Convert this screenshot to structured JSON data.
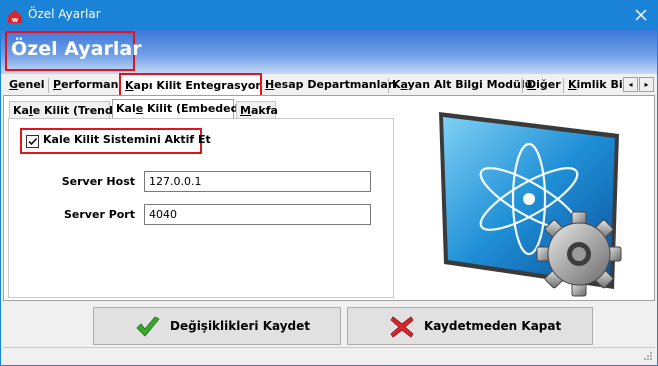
{
  "window": {
    "title": "Özel Ayarlar",
    "close_glyph": "✕"
  },
  "header": {
    "title": "Özel Ayarlar"
  },
  "main_tabs": [
    {
      "label": "Genel",
      "accel": "G",
      "rest": "enel"
    },
    {
      "label": "Performans",
      "accel": "P",
      "rest": "erformans"
    },
    {
      "label": "Kapı Kilit Entegrasyonu",
      "accel": "K",
      "rest": "apı Kilit Entegrasyonu",
      "active": true
    },
    {
      "label": "Hesap Departmanları",
      "accel": "H",
      "rest": "esap Departmanları"
    },
    {
      "label": "Kayan Alt Bilgi Modülü",
      "accel": "a",
      "pre": "K",
      "rest": "yan Alt Bilgi Modülü"
    },
    {
      "label": "Diğer",
      "accel": "D",
      "rest": "iğer"
    },
    {
      "label": "Kimlik Bild",
      "accel": "K",
      "rest": "imlik Bild"
    }
  ],
  "tab_scroll": {
    "left": "◂",
    "right": "▸"
  },
  "sub_tabs": [
    {
      "label": "Kale Kilit (Trend)",
      "accel": "l",
      "pre": "Ka",
      "rest": "e Kilit (Trend)"
    },
    {
      "label": "Kale Kilit (Embeded)",
      "accel": "e",
      "pre": "Kal",
      "rest": " Kilit (Embeded)",
      "active": true
    },
    {
      "label": "Makfa",
      "accel": "M",
      "rest": "akfa"
    }
  ],
  "form": {
    "enable_checkbox": {
      "label": "Kale Kilit Sistemini Aktif Et",
      "checked": true
    },
    "server_host": {
      "label": "Server Host",
      "value": "127.0.0.1"
    },
    "server_port": {
      "label": "Server Port",
      "value": "4040"
    }
  },
  "buttons": {
    "save": "Değişiklikleri Kaydet",
    "cancel": "Kaydetmeden Kapat"
  },
  "colors": {
    "titlebar": "#1a83d8",
    "highlight_red": "#e0141c",
    "save_icon_green": "#3aa82a",
    "cancel_icon_red": "#d8262c"
  },
  "icons": {
    "app": "app-logo-icon",
    "close": "close-icon",
    "save": "check-icon",
    "cancel": "x-icon",
    "graphic": "atom-gear-icon"
  }
}
